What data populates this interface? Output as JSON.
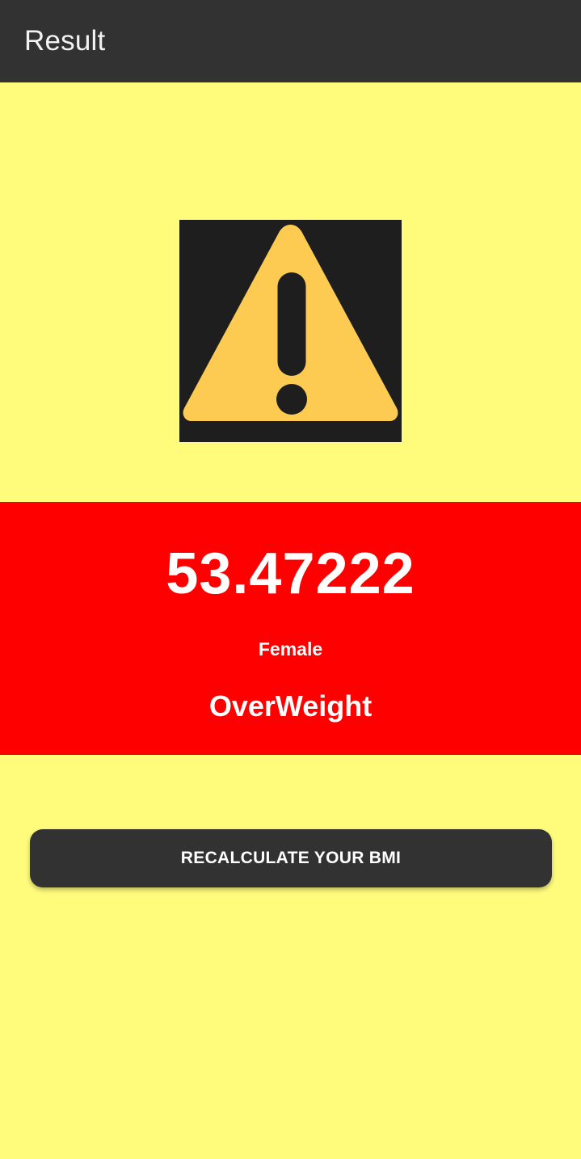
{
  "app_bar": {
    "title": "Result"
  },
  "warning": {
    "icon": "warning-triangle-icon",
    "background_color": "#1E1E1E",
    "triangle_color": "#FECB52",
    "mark_color": "#1E1E1E"
  },
  "result": {
    "bmi_value": "53.47222",
    "gender": "Female",
    "category": "OverWeight",
    "band_color": "#FF0000"
  },
  "actions": {
    "recalculate_label": "RECALCULATE YOUR BMI"
  },
  "colors": {
    "page_background": "#FFFC7C",
    "app_bar": "#323232",
    "button": "#323232",
    "text_on_dark": "#FFFFFF"
  }
}
